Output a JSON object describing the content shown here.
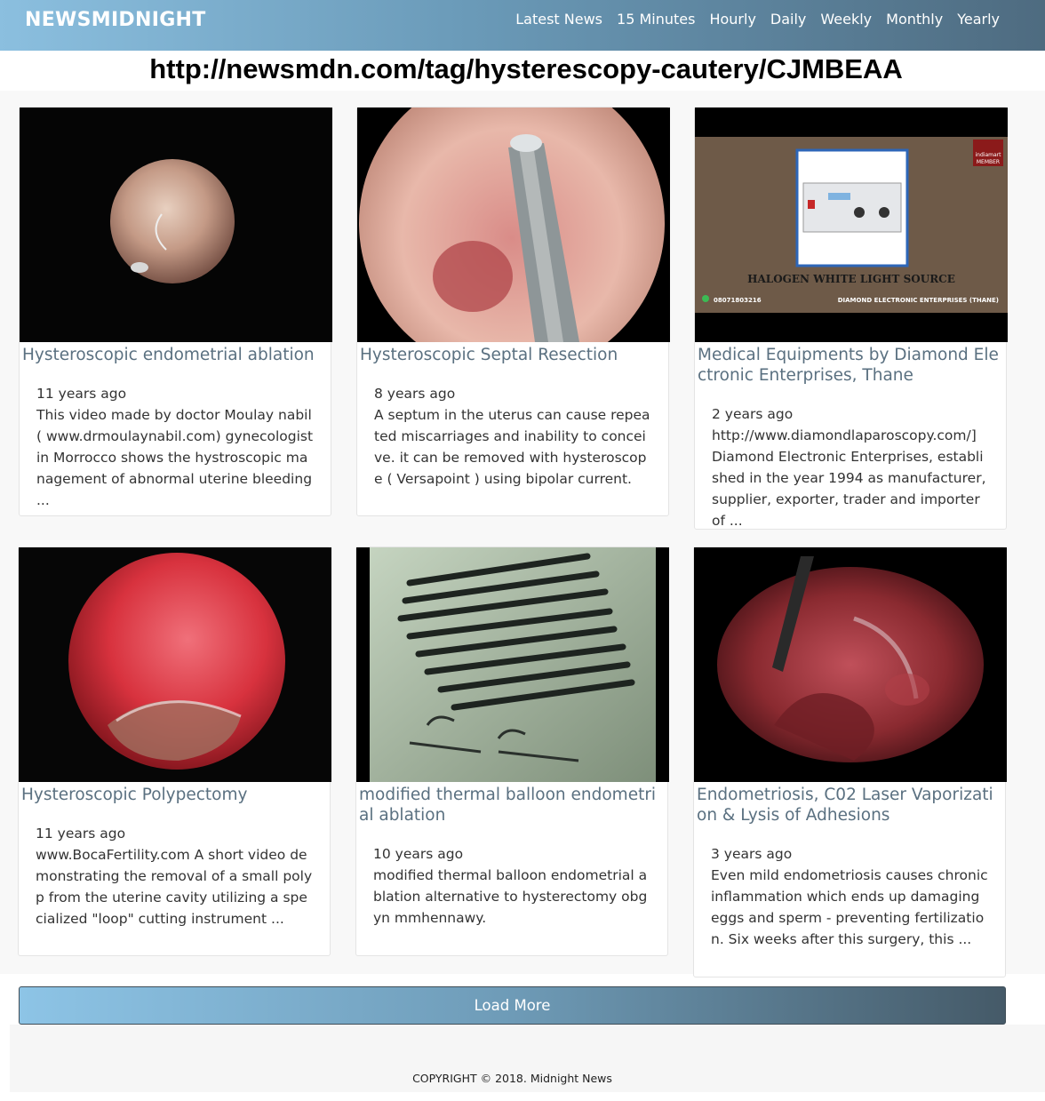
{
  "header": {
    "brand": "NEWSMIDNIGHT",
    "nav": [
      "Latest News",
      "15 Minutes",
      "Hourly",
      "Daily",
      "Weekly",
      "Monthly",
      "Yearly"
    ]
  },
  "page_url": "http://newsmdn.com/tag/hysterescopy-cautery/CJMBEAA",
  "cards": [
    {
      "title": "Hysteroscopic endometrial ablation",
      "date": "11 years ago",
      "desc": "This video made by doctor Moulay nabil( www.drmoulaynabil.com) gynecologist in Morrocco shows the hystroscopic management of abnormal uterine bleeding ..."
    },
    {
      "title": "Hysteroscopic Septal Resection",
      "date": "8 years ago",
      "desc": "A septum in the uterus can cause repeated miscarriages and inability to conceive. it can be removed with hysteroscope ( Versapoint ) using bipolar current."
    },
    {
      "title": "Medical Equipments by Diamond Electronic Enterprises, Thane",
      "date": "2 years ago",
      "desc": "http://www.diamondlaparoscopy.com/] Diamond Electronic Enterprises, established in the year 1994 as manufacturer, supplier, exporter, trader and importer of ...",
      "thumb_text": {
        "badge_top": "indiamart",
        "badge_bottom": "MEMBER",
        "product": "HALOGEN WHITE LIGHT SOURCE",
        "phone": "08071803216",
        "company": "DIAMOND ELECTRONIC ENTERPRISES (THANE)"
      }
    },
    {
      "title": "Hysteroscopic Polypectomy",
      "date": "11 years ago",
      "desc": "www.BocaFertility.com A short video demonstrating the removal of a small polyp from the uterine cavity utilizing a specialized \"loop\" cutting instrument ..."
    },
    {
      "title": "modified thermal balloon endometrial ablation",
      "date": "10 years ago",
      "desc": "modified thermal balloon endometrial ablation alternative to hysterectomy obgyn mmhennawy."
    },
    {
      "title": "Endometriosis, C02 Laser Vaporization & Lysis of Adhesions",
      "date": "3 years ago",
      "desc": "Even mild endometriosis causes chronic inflammation which ends up damaging eggs and sperm - preventing fertilization. Six weeks after this surgery, this ..."
    }
  ],
  "load_more": "Load More",
  "footer": "COPYRIGHT © 2018. Midnight News"
}
